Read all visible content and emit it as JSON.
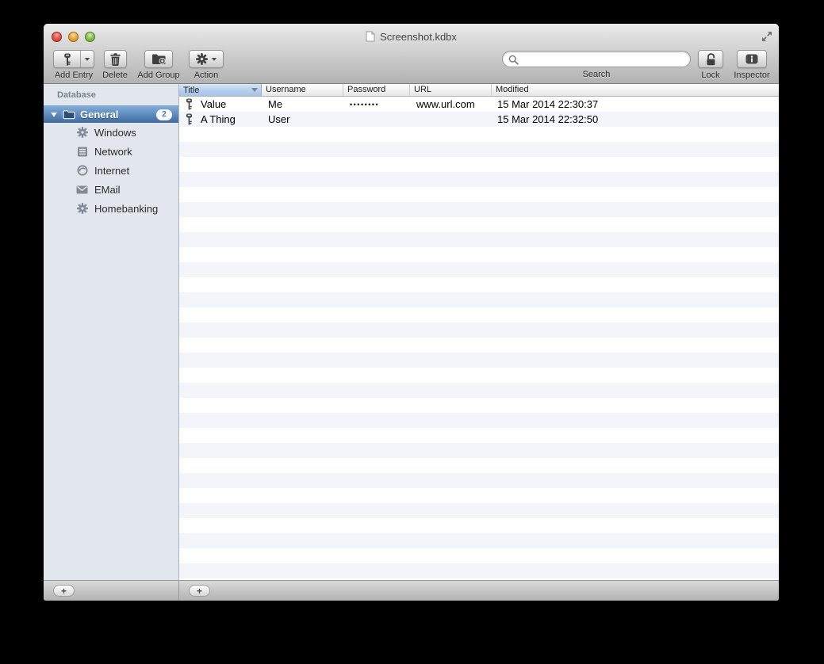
{
  "window": {
    "title": "Screenshot.kdbx"
  },
  "toolbar": {
    "add_entry_label": "Add Entry",
    "add_entry_icon": "key-icon",
    "delete_label": "Delete",
    "delete_icon": "trash-icon",
    "add_group_label": "Add Group",
    "add_group_icon": "folder-plus-icon",
    "action_label": "Action",
    "action_icon": "gear-icon",
    "search_label": "Search",
    "search_value": "",
    "search_icon": "magnifier-icon",
    "lock_label": "Lock",
    "lock_icon": "open-padlock-icon",
    "inspector_label": "Inspector",
    "inspector_icon": "info-icon"
  },
  "sidebar": {
    "header": "Database",
    "group": {
      "label": "General",
      "badge": "2",
      "icon": "folder-icon",
      "expanded": true
    },
    "items": [
      {
        "label": "Windows",
        "icon": "gear-icon"
      },
      {
        "label": "Network",
        "icon": "server-icon"
      },
      {
        "label": "Internet",
        "icon": "globe-icon"
      },
      {
        "label": "EMail",
        "icon": "envelope-icon"
      },
      {
        "label": "Homebanking",
        "icon": "gear-icon"
      }
    ]
  },
  "table": {
    "columns": [
      "Title",
      "Username",
      "Password",
      "URL",
      "Modified"
    ],
    "sort_column": "Title",
    "sort_direction": "descending",
    "rows": [
      {
        "icon": "key-icon",
        "title": "Value",
        "username": "Me",
        "password": "••••••••",
        "url": "www.url.com",
        "modified": "15 Mar 2014 22:30:37"
      },
      {
        "icon": "key-icon",
        "title": "A Thing",
        "username": "User",
        "password": "",
        "url": "",
        "modified": "15 Mar 2014 22:32:50"
      }
    ]
  },
  "bottom": {
    "add_group_button": "+",
    "add_entry_button": "+"
  },
  "colors": {
    "selection_blue_top": "#83abd6",
    "selection_blue_bottom": "#41699c",
    "sorted_header_blue": "#b3cdec",
    "row_stripe": "#f2f5fa",
    "sidebar_background": "#e2e7ee"
  }
}
